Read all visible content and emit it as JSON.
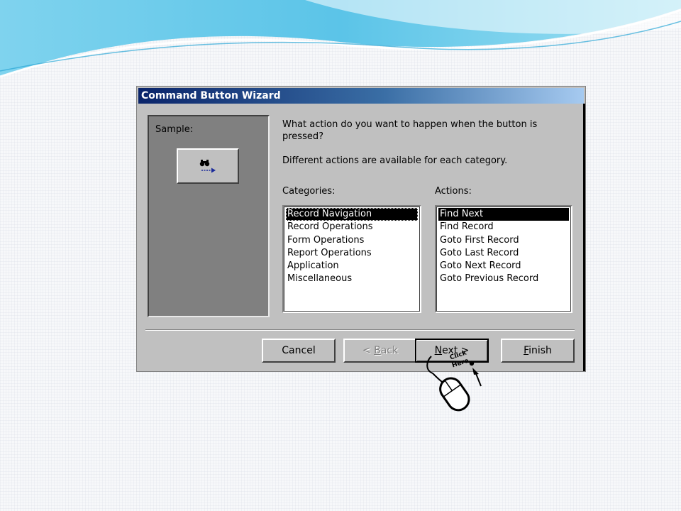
{
  "dialog": {
    "title": "Command Button Wizard",
    "sample_label": "Sample:",
    "question": "What action do you want to happen when the button is pressed?",
    "categories_note": "Different actions are available for each category.",
    "categories_label": "Categories:",
    "actions_label": "Actions:",
    "categories": [
      "Record Navigation",
      "Record Operations",
      "Form Operations",
      "Report Operations",
      "Application",
      "Miscellaneous"
    ],
    "actions": [
      "Find Next",
      "Find Record",
      "Goto First Record",
      "Goto Last Record",
      "Goto Next Record",
      "Goto Previous Record"
    ],
    "selected_category": "Record Navigation",
    "selected_action": "Find Next",
    "buttons": {
      "cancel": "Cancel",
      "back_prefix": "< ",
      "back_key": "B",
      "back_rest": "ack",
      "next_key": "N",
      "next_rest": "ext >",
      "finish_key": "F",
      "finish_rest": "inish"
    }
  },
  "overlay": {
    "click_label": "Click",
    "here_label": "Here"
  },
  "colors": {
    "titlebar_start": "#0a246a",
    "dialog_bg": "#c0c0c0",
    "wave": "#5bc4e8"
  },
  "icons": {
    "sample_icon": "binoculars-arrow-icon",
    "mouse": "mouse-icon"
  }
}
